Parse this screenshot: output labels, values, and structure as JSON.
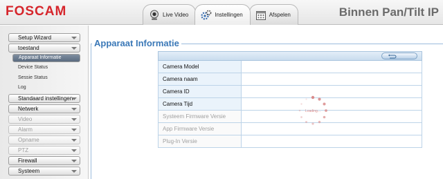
{
  "header": {
    "logo": "FOSCAM",
    "title": "Binnen Pan/Tilt IP",
    "tabs": [
      {
        "label": "Live Video",
        "icon": "webcam-icon"
      },
      {
        "label": "Instellingen",
        "icon": "gear-icon"
      },
      {
        "label": "Afspelen",
        "icon": "calendar-icon"
      }
    ]
  },
  "sidebar": {
    "items": [
      {
        "label": "Setup Wizard",
        "enabled": true
      },
      {
        "label": "toestand",
        "enabled": true
      },
      {
        "label": "Standaard instellingen",
        "enabled": true
      },
      {
        "label": "Netwerk",
        "enabled": true
      },
      {
        "label": "Video",
        "enabled": false
      },
      {
        "label": "Alarm",
        "enabled": false
      },
      {
        "label": "Opname",
        "enabled": false
      },
      {
        "label": "PTZ",
        "enabled": false
      },
      {
        "label": "Firewall",
        "enabled": true
      },
      {
        "label": "Systeem",
        "enabled": true
      }
    ],
    "subitems": [
      {
        "label": "Apparaat Informatie",
        "active": true
      },
      {
        "label": "Device Status",
        "active": false
      },
      {
        "label": "Sessie Status",
        "active": false
      },
      {
        "label": "Log",
        "active": false
      }
    ]
  },
  "main": {
    "section_title": "Apparaat Informatie",
    "rows": [
      {
        "label": "Camera Model",
        "value": ""
      },
      {
        "label": "Camera naam",
        "value": ""
      },
      {
        "label": "Camera ID",
        "value": ""
      },
      {
        "label": "Camera Tijd",
        "value": ""
      },
      {
        "label": "Systeem Firmware Versie",
        "value": ""
      },
      {
        "label": "App Firmware Versie",
        "value": ""
      },
      {
        "label": "Plug-In Versie",
        "value": ""
      }
    ],
    "loading_text": "Loading..."
  },
  "colors": {
    "brand": "#d6262c",
    "accent": "#3a78b7"
  }
}
